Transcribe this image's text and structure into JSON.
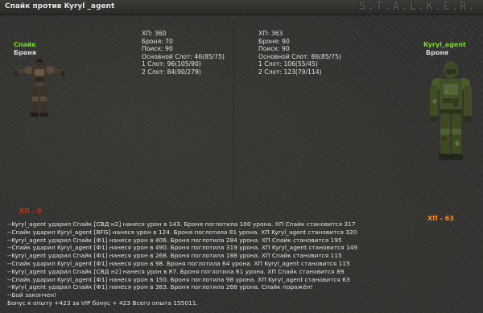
{
  "window": {
    "title": "Спайк против Kyryl _agent",
    "logo": "S.T.A.L.K.E.R."
  },
  "left_fighter": {
    "name": "Спайк",
    "armor_label": "Броня",
    "stats": [
      "ХП: 360",
      "Броня: 70",
      "Поиск: 90",
      "Основной Слот: 46(85/75)",
      "1 Слот: 96(105/90)",
      "2 Слот: 84(90/279)"
    ],
    "hp_status": "ХП - 0"
  },
  "right_fighter": {
    "name": "Kyryl_agent",
    "armor_label": "Броня",
    "stats": [
      "ХП: 363",
      "Броня: 90",
      "Поиск: 90",
      "Основной Слот: 86(85/75)",
      "1 Слот: 106(55/45)",
      "2 Слот: 123(79/114)"
    ],
    "hp_status": "ХП - 63"
  },
  "battle_log": [
    "--Kyryl_agent ударил Спайк [СВД н2] нанеся урон в 143. Броня поглотила 100 урона. ХП Спайк становится 317",
    "--Спайк ударил Kyryl_agent [BFG] нанеся урон в 124. Броня поглотила 81 урона. ХП Kyryl_agent становится 320",
    "--Kyryl_agent ударил Спайк [Ф1] нанеся урон в 406. Броня поглотила 284 урона. ХП Спайк становится 195",
    "--Спайк ударил Kyryl_agent [Ф1] нанеся урон в 490. Броня поглотила 319 урона. ХП Kyryl_agent становится 149",
    "--Kyryl_agent ударил Спайк [Ф1] нанеся урон в 268. Броня поглотила 188 урона. ХП Спайк становится 115",
    "--Спайк ударил Kyryl_agent [Ф1] нанеся урон в 98. Броня поглотила 64 урона. ХП Kyryl_agent становится 115",
    "--Kyryl_agent ударил Спайк [СВД н2] нанеся урон в 87. Броня поглотила 61 урона. ХП Спайк становится 89",
    "--Спайк ударил Kyryl_agent [Ф1] нанеся урон в 150. Броня поглотила 98 урона. ХП Kyryl_agent становится 63",
    "--Kyryl_agent ударил Спайк [Ф1] нанеся урон в 383. Броня поглотила 268 урона. Спайк поражён!",
    "--Бой закончен!",
    "Бонус к опыту +423 за VIP бонус + 423 Всего опыта 155011."
  ],
  "colors": {
    "name_accent": "#77dd22",
    "hp_zero": "#dd2a0a",
    "hp_remaining": "#ff8a1e",
    "background": "#333333"
  },
  "icons": {
    "left_sprite": "exoskeleton-armor-figure",
    "right_sprite": "camo-armor-soldier-figure"
  }
}
